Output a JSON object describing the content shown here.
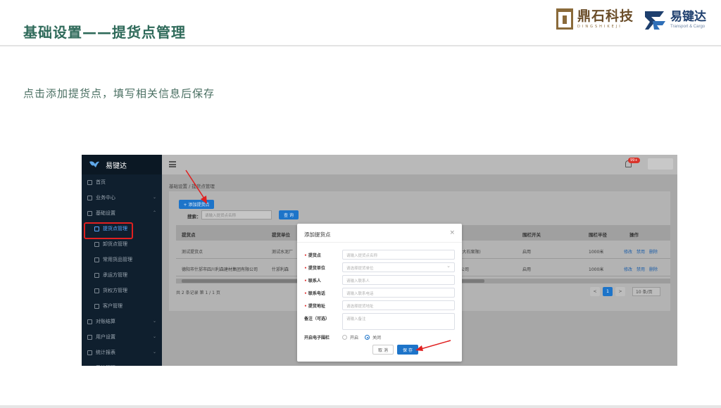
{
  "slide": {
    "title": "基础设置——提货点管理",
    "caption": "点击添加提货点，填写相关信息后保存",
    "logo_left": {
      "name": "鼎石科技",
      "sub": "DINGSHIKEJI"
    },
    "logo_right": {
      "name": "易键达",
      "sub": "Transport & Cargo"
    }
  },
  "app": {
    "brand": "易键达",
    "nav": [
      {
        "label": "首页",
        "icon": "home-icon"
      },
      {
        "label": "业务中心",
        "icon": "grid-icon",
        "chevron": "⌄"
      },
      {
        "label": "基础设置",
        "icon": "gear-icon",
        "chevron": "⌃"
      },
      {
        "label": "提货点管理",
        "icon": "location-icon",
        "active": true
      },
      {
        "label": "卸货点管理",
        "icon": "location-icon"
      },
      {
        "label": "常用货品管理",
        "icon": "box-icon"
      },
      {
        "label": "承运方管理",
        "icon": "truck-icon"
      },
      {
        "label": "货权方管理",
        "icon": "user-icon"
      },
      {
        "label": "客户管理",
        "icon": "users-icon"
      },
      {
        "label": "对账结算",
        "icon": "money-icon",
        "chevron": "⌄"
      },
      {
        "label": "用户设置",
        "icon": "user-icon",
        "chevron": "⌄"
      },
      {
        "label": "统计报表",
        "icon": "chart-icon",
        "chevron": "⌄"
      },
      {
        "label": "系统管理",
        "icon": "settings-icon",
        "chevron": "⌄"
      }
    ],
    "topbar": {
      "badge": "99+"
    },
    "breadcrumb": "基础设置 / 提货点管理",
    "toolbar": {
      "add_label": "+ 添加提货点",
      "search_label": "搜索：",
      "search_placeholder": "请输入提货点名称",
      "query_label": "查 询"
    },
    "table": {
      "headers": [
        "提货点",
        "提货单位",
        "围栏开关",
        "围栏半径",
        "操作"
      ],
      "rows": [
        {
          "point": "测试提货点",
          "unit": "测试水泥厂",
          "extra": "司(大石案限)",
          "fence": "启用",
          "radius": "1000米",
          "ops": [
            "修改",
            "禁用",
            "删除"
          ]
        },
        {
          "point": "德阳市什邡市四川利森建材集团有限公司",
          "unit": "什邡利森",
          "extra": "限公司",
          "fence": "启用",
          "radius": "1000米",
          "ops": [
            "修改",
            "禁用",
            "删除"
          ]
        }
      ]
    },
    "pagination": {
      "total": "共 2 条记录 第 1 / 1 页",
      "prev": "<",
      "current": "1",
      "next": ">",
      "size": "10 条/页"
    }
  },
  "dialog": {
    "title": "添加提货点",
    "close": "×",
    "fields": [
      {
        "label": "提货点",
        "required": true,
        "placeholder": "请输入提货点名称"
      },
      {
        "label": "提货单位",
        "required": true,
        "placeholder": "请选择提货单位"
      },
      {
        "label": "联系人",
        "required": true,
        "placeholder": "请输入联系人"
      },
      {
        "label": "联系电话",
        "required": true,
        "placeholder": "请输入联系电话"
      },
      {
        "label": "提货地址",
        "required": true,
        "placeholder": "请选择提货地址"
      },
      {
        "label": "备注（可选）",
        "required": false,
        "placeholder": "请输入备注"
      }
    ],
    "fence_label": "开启电子围栏",
    "fence_on": "开启",
    "fence_off": "关闭",
    "fence_selected": "关闭",
    "cancel_label": "取 消",
    "save_label": "保 存"
  },
  "colors": {
    "accent": "#1d74c9",
    "title": "#2f6a5a",
    "arrow": "#e02020"
  }
}
